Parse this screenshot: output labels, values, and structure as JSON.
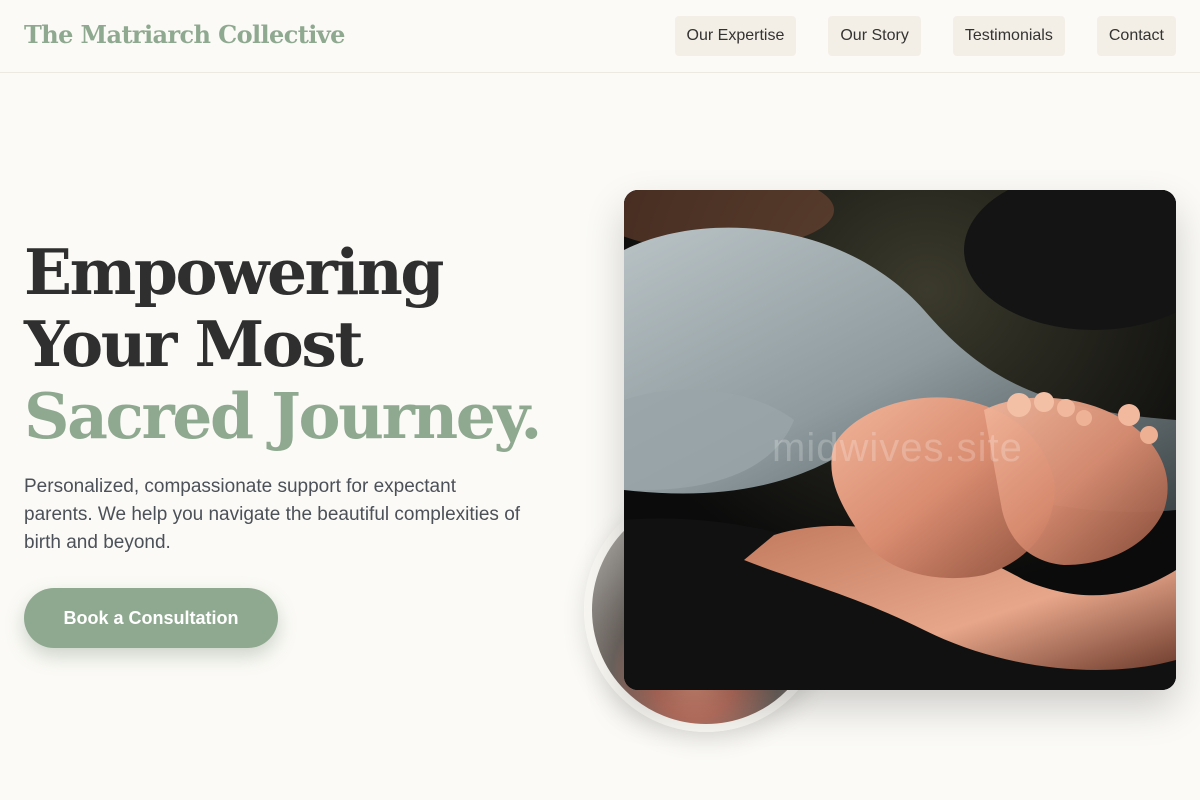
{
  "header": {
    "brand": "The Matriarch Collective",
    "nav": [
      {
        "label": "Our Expertise"
      },
      {
        "label": "Our Story"
      },
      {
        "label": "Testimonials"
      },
      {
        "label": "Contact"
      }
    ]
  },
  "hero": {
    "title_line1": "Empowering",
    "title_line2": "Your Most",
    "title_line3": "Sacred Journey.",
    "subtitle": "Personalized, compassionate support for expectant parents. We help you navigate the beautiful complexities of birth and beyond.",
    "cta_label": "Book a Consultation"
  },
  "images": {
    "main_photo": "newborn-feet-in-hands-photo",
    "secondary_photo": "baby-circle-photo",
    "watermark": "midwives.site"
  },
  "colors": {
    "accent": "#8fa990",
    "background": "#fbfaf6",
    "text_dark": "#2f2f2f",
    "nav_bg": "#f3efe6"
  }
}
